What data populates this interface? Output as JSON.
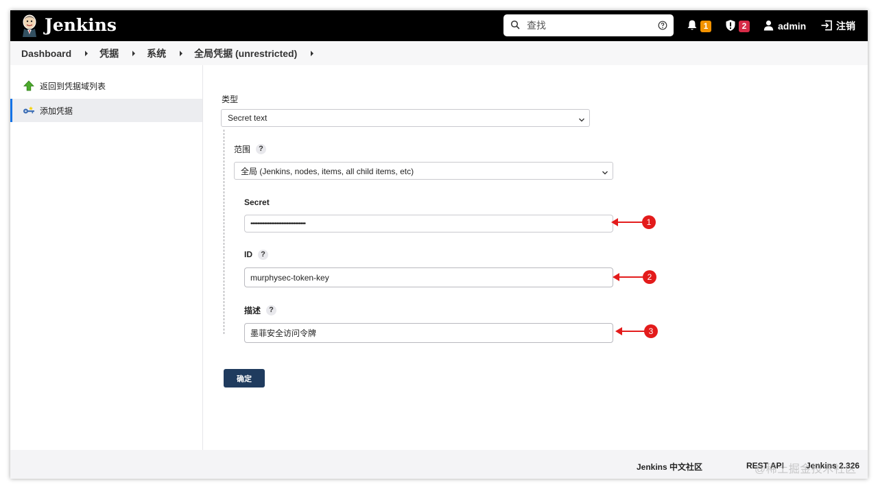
{
  "header": {
    "brand": "Jenkins",
    "search_placeholder": "查找",
    "notifications_count": "1",
    "security_count": "2",
    "user": "admin",
    "logout": "注销"
  },
  "breadcrumb": [
    "Dashboard",
    "凭据",
    "系统",
    "全局凭据 (unrestricted)"
  ],
  "sidebar": {
    "items": [
      {
        "label": "返回到凭据域列表",
        "icon": "green-up-arrow-icon"
      },
      {
        "label": "添加凭据",
        "icon": "key-icon"
      }
    ]
  },
  "form": {
    "kind_label": "类型",
    "kind_value": "Secret text",
    "scope_label": "范围",
    "scope_help": "?",
    "scope_value": "全局 (Jenkins, nodes, items, all child items, etc)",
    "secret_label": "Secret",
    "secret_value": "••••••••••••••••••••••••••••••••",
    "id_label": "ID",
    "id_help": "?",
    "id_value": "murphysec-token-key",
    "desc_label": "描述",
    "desc_help": "?",
    "desc_value": "墨菲安全访问令牌",
    "submit": "确定"
  },
  "annotations": [
    "1",
    "2",
    "3"
  ],
  "footer": {
    "community": "Jenkins 中文社区",
    "rest_api": "REST API",
    "version": "Jenkins 2.326",
    "watermark": "@稀土掘金技术社区"
  },
  "colors": {
    "header_bg": "#000000",
    "accent": "#1473e6",
    "submit_bg": "#1f3b5e",
    "annotation_red": "#e31b1b",
    "badge_orange": "#f29200",
    "badge_red": "#d62b47"
  }
}
